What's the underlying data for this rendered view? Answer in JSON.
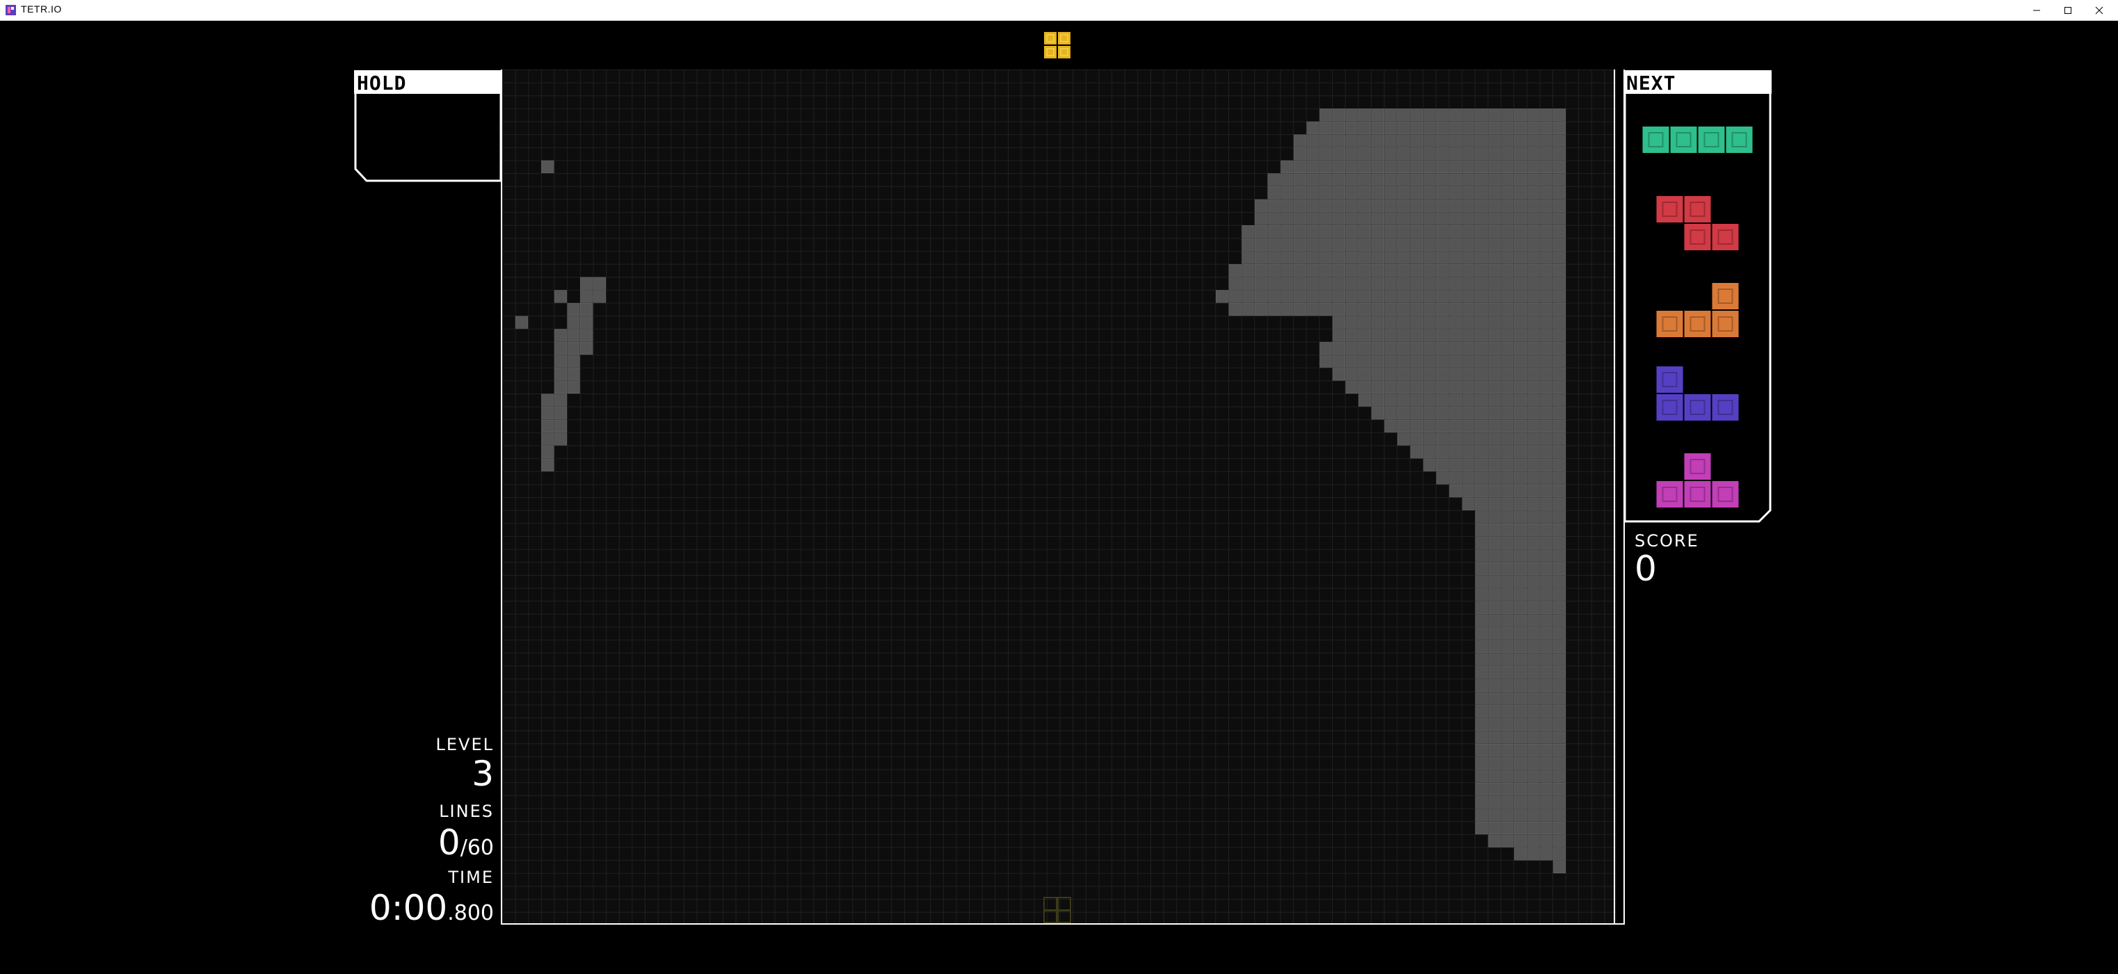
{
  "window": {
    "title": "TETR.IO",
    "minimize_icon": "minimize-icon",
    "maximize_icon": "maximize-icon",
    "close_icon": "close-icon"
  },
  "colors": {
    "background": "#000000",
    "board": "#0d0d0d",
    "garbage": "#555555",
    "O": "#e6b51a",
    "I": "#2ebf8c",
    "Z": "#d23a45",
    "L": "#db7a37",
    "J": "#5540c4",
    "T": "#c23fb8"
  },
  "hold": {
    "label": "HOLD",
    "piece": ""
  },
  "next": {
    "label": "NEXT",
    "queue": [
      "I",
      "Z",
      "L",
      "J",
      "T"
    ]
  },
  "stats": {
    "level_label": "LEVEL",
    "level_value": "3",
    "lines_label": "LINES",
    "lines_value": "0",
    "lines_goal": "/60",
    "time_label": "TIME",
    "time_main": "0:00",
    "time_ms": ".800",
    "score_label": "SCORE",
    "score_value": "0"
  },
  "active_piece": {
    "type": "O"
  }
}
